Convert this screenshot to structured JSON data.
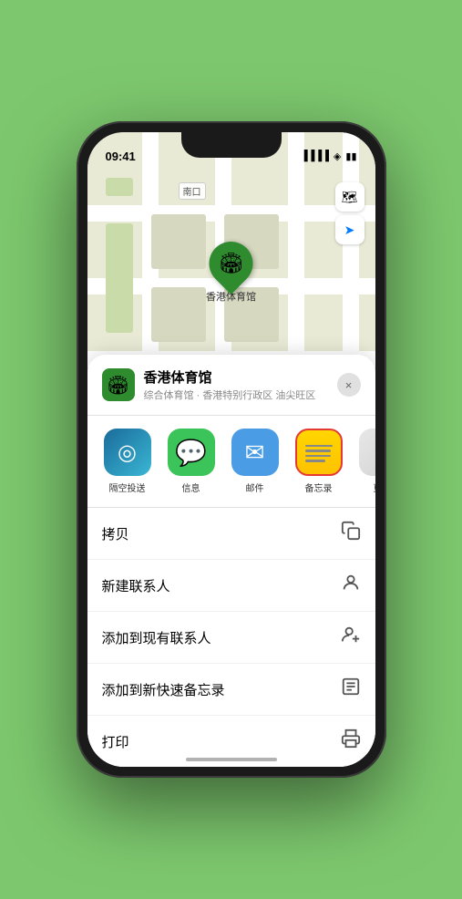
{
  "status_bar": {
    "time": "09:41",
    "signal": "●●●●",
    "wifi": "wifi",
    "battery": "battery"
  },
  "map": {
    "label_north": "南口",
    "pin_label": "香港体育馆"
  },
  "map_controls": {
    "map_type_icon": "🗺",
    "location_icon": "➤"
  },
  "location_card": {
    "name": "香港体育馆",
    "subtitle": "综合体育馆 · 香港特别行政区 油尖旺区",
    "close_label": "×"
  },
  "share_items": [
    {
      "id": "airdrop",
      "label": "隔空投送",
      "type": "airdrop"
    },
    {
      "id": "message",
      "label": "信息",
      "type": "message"
    },
    {
      "id": "mail",
      "label": "邮件",
      "type": "mail"
    },
    {
      "id": "notes",
      "label": "备忘录",
      "type": "notes",
      "highlighted": true
    },
    {
      "id": "more",
      "label": "更多",
      "type": "more"
    }
  ],
  "actions": [
    {
      "id": "copy",
      "label": "拷贝",
      "icon": "copy"
    },
    {
      "id": "new-contact",
      "label": "新建联系人",
      "icon": "person"
    },
    {
      "id": "add-existing",
      "label": "添加到现有联系人",
      "icon": "person-add"
    },
    {
      "id": "add-notes",
      "label": "添加到新快速备忘录",
      "icon": "note"
    },
    {
      "id": "print",
      "label": "打印",
      "icon": "printer"
    }
  ]
}
